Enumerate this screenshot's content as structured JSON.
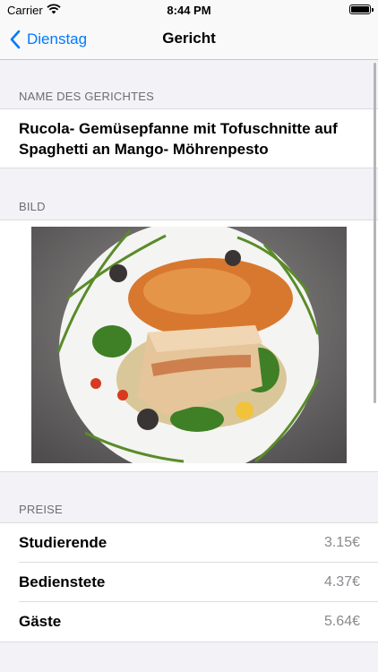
{
  "status_bar": {
    "carrier": "Carrier",
    "time": "8:44 PM"
  },
  "nav": {
    "back_label": "Dienstag",
    "title": "Gericht"
  },
  "sections": {
    "name_header": "NAME DES GERICHTES",
    "image_header": "BILD",
    "prices_header": "PREISE"
  },
  "dish": {
    "name": "Rucola- Gemüsepfanne mit Tofuschnitte auf Spaghetti an Mango- Möhrenpesto"
  },
  "prices": [
    {
      "label": "Studierende",
      "value": "3.15€"
    },
    {
      "label": "Bedienstete",
      "value": "4.37€"
    },
    {
      "label": "Gäste",
      "value": "5.64€"
    }
  ],
  "colors": {
    "accent": "#007aff",
    "background": "#f2f2f7",
    "secondary_text": "#6d6d72"
  },
  "icons": {
    "back": "chevron-left-icon",
    "wifi": "wifi-icon",
    "battery": "battery-icon"
  }
}
